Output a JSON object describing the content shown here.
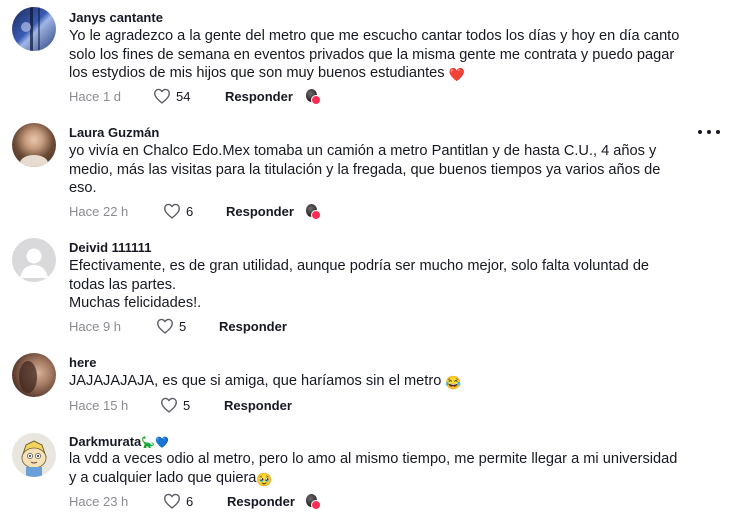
{
  "comments": [
    {
      "username": "Janys cantante",
      "text": "Yo le agradezco a la gente del metro que me escucho cantar todos los días y hoy en día canto\nsolo los fines de semana en eventos privados que la misma gente me contrata y puedo pagar\nlos estydios de mis hijos que son muy buenos estudiantes",
      "emoji": "❤️",
      "time": "Hace 1 d",
      "likes": "54",
      "reply": "Responder"
    },
    {
      "username": "Laura Guzmán",
      "text": "yo vivía en Chalco Edo.Mex tomaba un camión a metro Pantitlan y de hasta C.U., 4 años y\nmedio, más las visitas para la titulación y la fregada, que buenos tiempos ya varios años de\neso.",
      "emoji": "",
      "time": "Hace 22 h",
      "likes": "6",
      "reply": "Responder"
    },
    {
      "username": "Deivid 111111",
      "text": "Efectivamente, es de gran utilidad, aunque podría ser mucho mejor, solo falta voluntad de\ntodas las partes.\nMuchas felicidades!.",
      "emoji": "",
      "time": "Hace 9 h",
      "likes": "5",
      "reply": "Responder"
    },
    {
      "username": "here",
      "text": "JAJAJAJAJA, es que si amiga, que haríamos sin el metro",
      "emoji": "😂",
      "time": "Hace 15 h",
      "likes": "5",
      "reply": "Responder"
    },
    {
      "username": "Darkmurata",
      "username_emoji": "🦕💙",
      "text": "la vdd a veces odio al metro, pero lo amo al mismo tiempo, me permite llegar a mi universidad\ny a cualquier lado que quiera",
      "emoji": "🥹",
      "time": "Hace 23 h",
      "likes": "6",
      "reply": "Responder"
    }
  ],
  "colors": {
    "text": "#161823",
    "muted": "#8a8b91",
    "creator_heart": "#fe2c55"
  },
  "icons": {
    "like": "heart-outline-icon",
    "more": "more-dots-icon"
  }
}
